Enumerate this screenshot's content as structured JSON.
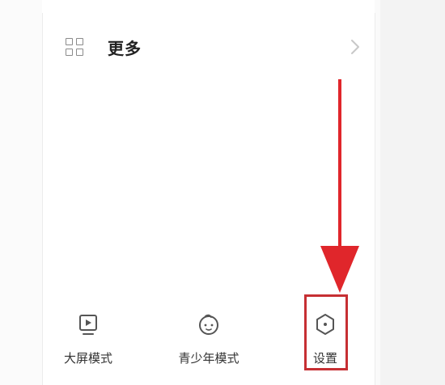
{
  "more_row": {
    "label": "更多",
    "icon": "grid-icon",
    "chevron_icon": "chevron-right-icon"
  },
  "actions": [
    {
      "label": "大屏模式",
      "icon": "play-screen-icon"
    },
    {
      "label": "青少年模式",
      "icon": "child-face-icon"
    },
    {
      "label": "设置",
      "icon": "hexagon-settings-icon"
    }
  ],
  "annotation": {
    "color": "#e0262b",
    "box_color": "#c62f33"
  }
}
